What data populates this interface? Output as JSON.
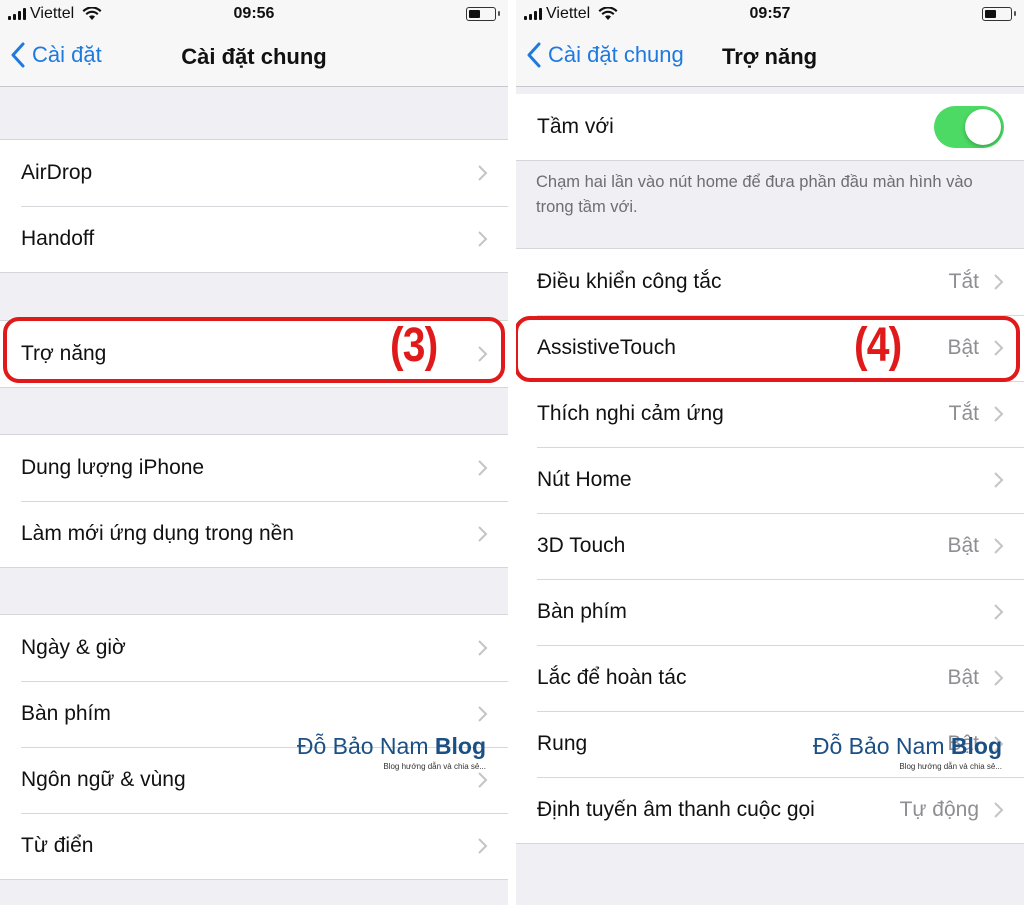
{
  "left": {
    "status_bar": {
      "carrier": "Viettel",
      "time": "09:56",
      "battery_level": 0.4
    },
    "nav": {
      "back_label": "Cài đặt",
      "title": "Cài đặt chung"
    },
    "groups": [
      {
        "rows": [
          {
            "label": "AirDrop"
          },
          {
            "label": "Handoff"
          }
        ]
      },
      {
        "rows": [
          {
            "label": "Trợ năng"
          }
        ]
      },
      {
        "rows": [
          {
            "label": "Dung lượng iPhone"
          },
          {
            "label": "Làm mới ứng dụng trong nền"
          }
        ]
      },
      {
        "rows": [
          {
            "label": "Ngày & giờ"
          },
          {
            "label": "Bàn phím"
          },
          {
            "label": "Ngôn ngữ & vùng"
          },
          {
            "label": "Từ điển"
          }
        ]
      }
    ],
    "annotation": {
      "step": "(3)",
      "target": "Trợ năng"
    }
  },
  "right": {
    "status_bar": {
      "carrier": "Viettel",
      "time": "09:57",
      "battery_level": 0.4
    },
    "nav": {
      "back_label": "Cài đặt chung",
      "title": "Trợ năng"
    },
    "reachability": {
      "label": "Tầm với",
      "enabled": true,
      "footer": "Chạm hai lần vào nút home để đưa phần đầu màn hình vào trong tầm với."
    },
    "rows": [
      {
        "label": "Điều khiển công tắc",
        "value": "Tắt"
      },
      {
        "label": "AssistiveTouch",
        "value": "Bật"
      },
      {
        "label": "Thích nghi cảm ứng",
        "value": "Tắt"
      },
      {
        "label": "Nút Home",
        "value": ""
      },
      {
        "label": "3D Touch",
        "value": "Bật"
      },
      {
        "label": "Bàn phím",
        "value": ""
      },
      {
        "label": "Lắc để hoàn tác",
        "value": "Bật"
      },
      {
        "label": "Rung",
        "value": "Bật"
      },
      {
        "label": "Định tuyến âm thanh cuộc gọi",
        "value": "Tự động"
      }
    ],
    "annotation": {
      "step": "(4)",
      "target": "AssistiveTouch"
    }
  },
  "watermark": {
    "name": "Đỗ Bảo Nam",
    "brand": "Blog",
    "tagline": "Blog hướng dẫn và chia sẻ..."
  },
  "colors": {
    "ios_blue": "#1f7ae0",
    "toggle_green": "#4cd964",
    "annotation_red": "#e01a1a",
    "watermark_blue": "#1c4f84"
  }
}
